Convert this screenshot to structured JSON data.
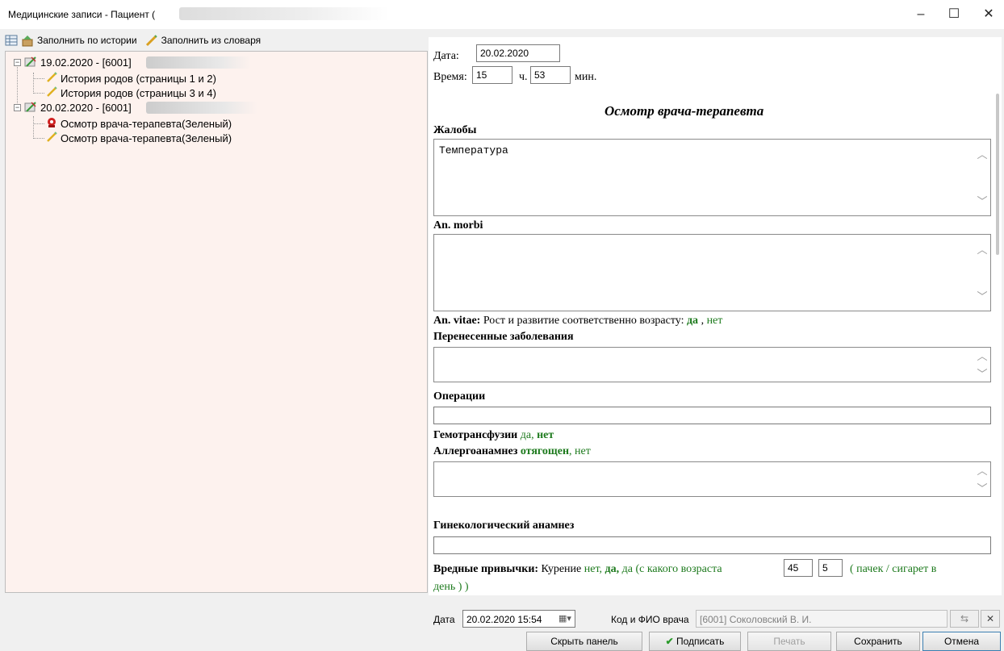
{
  "window": {
    "title": "Медицинские записи - Пациент ("
  },
  "toolbar": {
    "fill_history": "Заполнить по истории",
    "fill_dictionary": "Заполнить из словаря"
  },
  "tree": {
    "nodes": [
      {
        "label": "19.02.2020 - [6001]"
      },
      {
        "label": "История родов (страницы 1 и 2)"
      },
      {
        "label": "История родов (страницы 3 и 4)"
      },
      {
        "label": "20.02.2020 - [6001]"
      },
      {
        "label": "Осмотр врача-терапевта(Зеленый)"
      },
      {
        "label": "Осмотр врача-терапевта(Зеленый)"
      }
    ]
  },
  "form": {
    "date_label": "Дата:",
    "date_value": "20.02.2020",
    "time_label": "Время:",
    "hours": "15",
    "hours_unit": "ч.",
    "minutes": "53",
    "minutes_unit": "мин.",
    "heading": "Осмотр врача-терапевта",
    "complaints_label": "Жалобы",
    "complaints_value": "Температура",
    "an_morbi_label": "An. morbi",
    "an_vitae_label": "An. vitae:",
    "an_vitae_text": "Рост и развитие соответственно возрасту:",
    "an_vitae_yes": "да",
    "an_vitae_sep": ",",
    "an_vitae_no": "нет",
    "past_diseases_label": "Перенесенные заболевания",
    "operations_label": "Операции",
    "transfusion_label": "Гемотрансфузии",
    "transfusion_yes": "да,",
    "transfusion_no": "нет",
    "allergy_label": "Аллергоанамнез",
    "allergy_burdened": "отягощен",
    "allergy_no": ", нет",
    "gyn_label": "Гинекологический анамнез",
    "habits_label": "Вредные привычки:",
    "habits_smoking": "Курение",
    "habits_no": "нет,",
    "habits_yes": "да,",
    "habits_since": "да (с какого возраста",
    "habits_age": "45",
    "habits_count": "5",
    "habits_units": "( пачек / сигарет в",
    "habits_end": "день ) )"
  },
  "bottom": {
    "date_label": "Дата",
    "date_value": "20.02.2020 15:54",
    "doctor_label": "Код и ФИО врача",
    "doctor_value": "[6001] Соколовский В. И.",
    "hide_panel": "Скрыть панель",
    "sign": "Подписать",
    "print": "Печать",
    "save": "Сохранить",
    "cancel": "Отмена"
  },
  "colors": {
    "tree_bg": "#fdf2ee",
    "option_green": "#1d7a1d"
  }
}
